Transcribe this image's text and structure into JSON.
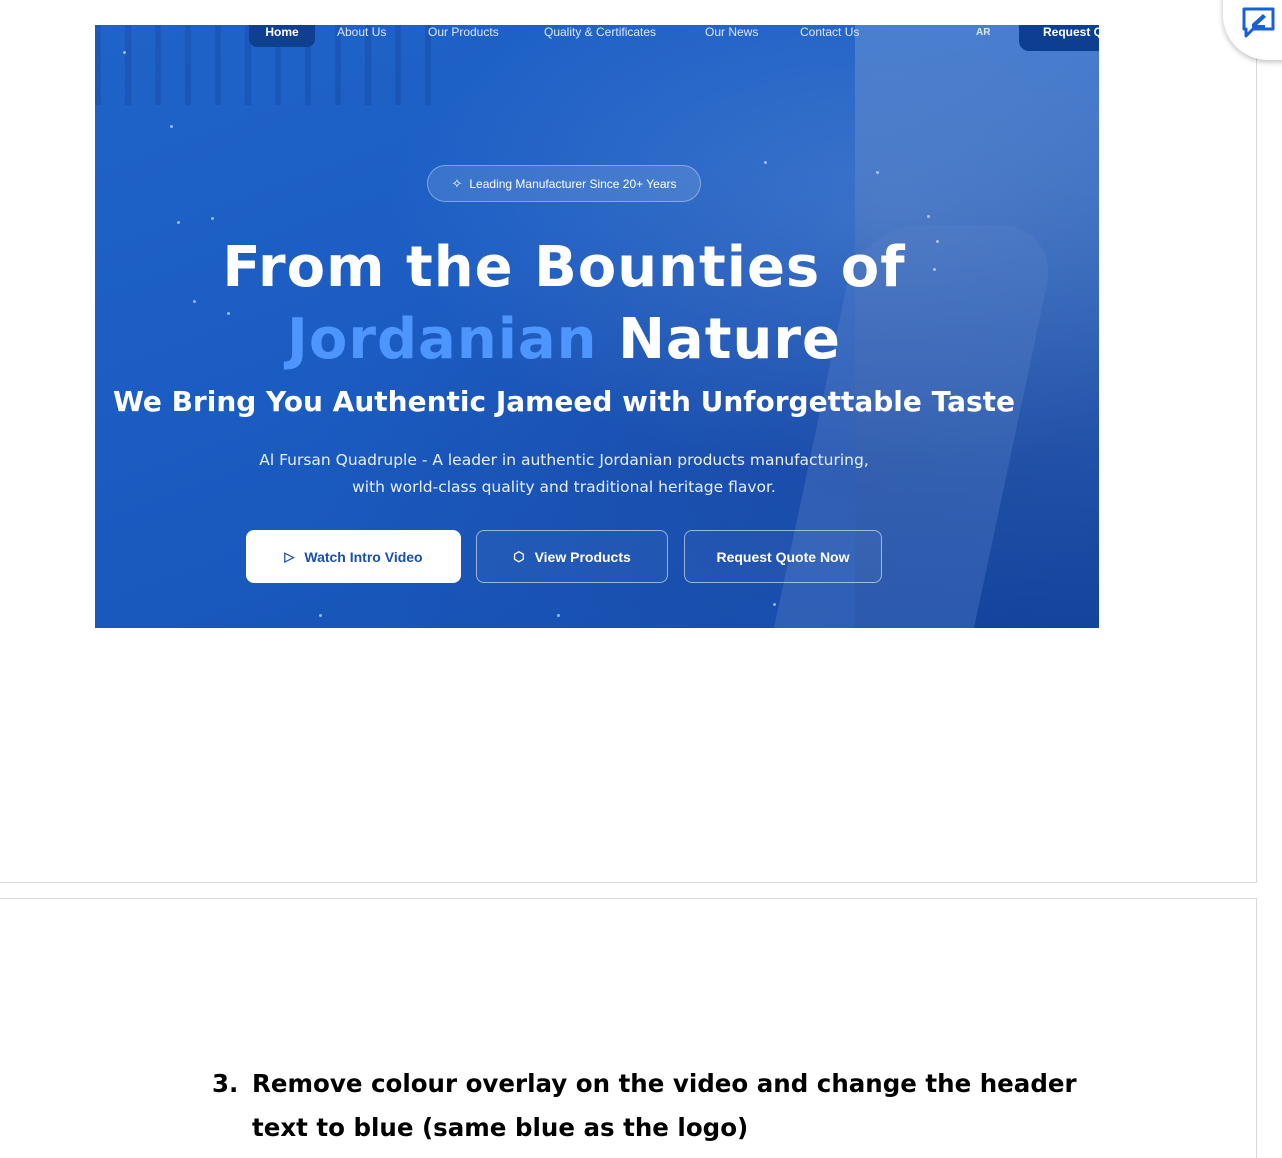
{
  "nav": {
    "items": [
      "Home",
      "About Us",
      "Our Products",
      "Quality & Certificates",
      "Our News",
      "Contact Us"
    ],
    "lang": "AR",
    "quote_button": "Request Q"
  },
  "hero": {
    "badge": "Leading Manufacturer Since 20+ Years",
    "badge_icon": "sparkle-icon",
    "title_line1": "From the Bounties of",
    "title_accent": "Jordanian",
    "title_rest": "Nature",
    "subtitle": "We Bring You Authentic Jameed with Unforgettable Taste",
    "description_line1": "Al Fursan Quadruple - A leader in authentic Jordanian products manufacturing,",
    "description_line2": "with world-class quality and traditional heritage flavor.",
    "buttons": {
      "video": "Watch Intro Video",
      "products": "View Products",
      "quote": "Request Quote Now"
    },
    "accent_color": "#4d96ff",
    "background_color": "#1f63c9"
  },
  "document": {
    "item_number": "3.",
    "item_text": "Remove colour overlay on the video and change the header text to blue (same blue as the logo)"
  },
  "toolbar": {
    "comment_icon": "add-comment-icon"
  }
}
